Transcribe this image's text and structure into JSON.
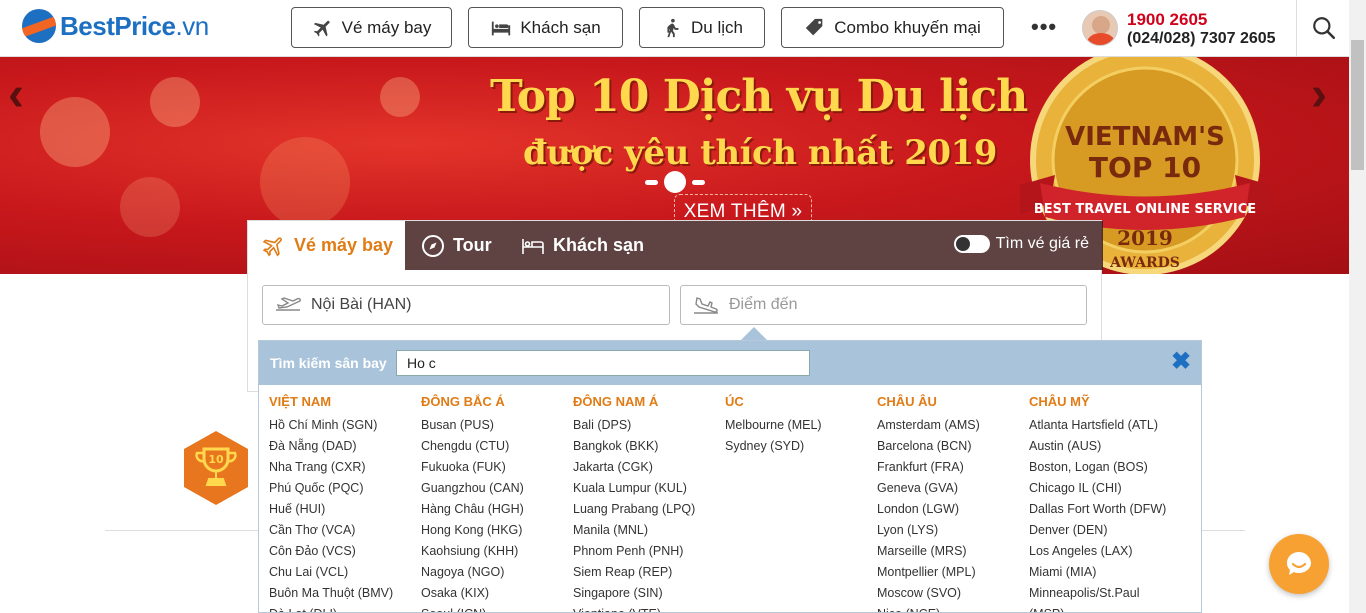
{
  "brand": {
    "logo_text": "BestPrice",
    "logo_suffix": ".vn",
    "brand_color": "#1d6fc2",
    "accent": "#f26522"
  },
  "nav": {
    "items": [
      {
        "label": "Vé máy bay",
        "icon": "plane-icon"
      },
      {
        "label": "Khách sạn",
        "icon": "bed-icon"
      },
      {
        "label": "Du lịch",
        "icon": "hiker-icon"
      },
      {
        "label": "Combo khuyến mại",
        "icon": "tag-icon"
      }
    ],
    "more": "•••",
    "hotline": "1900 2605",
    "phone": "(024/028) 7307 2605"
  },
  "banner": {
    "title": "Top 10 Dịch vụ Du lịch",
    "subtitle": "được yêu thích nhất 2019",
    "cta": "XEM THÊM »",
    "badge_line1": "VIETNAM'S",
    "badge_line2": "TOP 10",
    "badge_ribbon": "BEST TRAVEL ONLINE SERVICE",
    "badge_year": "2019",
    "badge_awards": "AWARDS",
    "prev": "‹",
    "next": "›"
  },
  "search": {
    "tabs": [
      {
        "label": "Vé máy bay",
        "active": true
      },
      {
        "label": "Tour",
        "active": false
      },
      {
        "label": "Khách sạn",
        "active": false
      }
    ],
    "cheap_toggle_label": "Tìm vé giá rẻ",
    "origin_value": "Nội Bài (HAN)",
    "destination_placeholder": "Điểm đến"
  },
  "airport_dropdown": {
    "label": "Tìm kiếm sân bay",
    "query": "Ho c",
    "close": "✖",
    "regions": [
      {
        "name": "VIỆT NAM",
        "airports": [
          "Hồ Chí Minh (SGN)",
          "Đà Nẵng (DAD)",
          "Nha Trang (CXR)",
          "Phú Quốc (PQC)",
          "Huế (HUI)",
          "Cần Thơ (VCA)",
          "Côn Đảo (VCS)",
          "Chu Lai (VCL)",
          "Buôn Ma Thuột (BMV)",
          "Đà Lạt (DLI)"
        ]
      },
      {
        "name": "ĐÔNG BẮC Á",
        "airports": [
          "Busan (PUS)",
          "Chengdu (CTU)",
          "Fukuoka (FUK)",
          "Guangzhou (CAN)",
          "Hàng Châu (HGH)",
          "Hong Kong (HKG)",
          "Kaohsiung (KHH)",
          "Nagoya (NGO)",
          "Osaka (KIX)",
          "Seoul (ICN)"
        ]
      },
      {
        "name": "ĐÔNG NAM Á",
        "airports": [
          "Bali (DPS)",
          "Bangkok (BKK)",
          "Jakarta (CGK)",
          "Kuala Lumpur (KUL)",
          "Luang Prabang (LPQ)",
          "Manila (MNL)",
          "Phnom Penh (PNH)",
          "Siem Reap (REP)",
          "Singapore (SIN)",
          "Vientiane (VTE)"
        ]
      },
      {
        "name": "ÚC",
        "airports": [
          "Melbourne (MEL)",
          "Sydney (SYD)"
        ]
      },
      {
        "name": "CHÂU ÂU",
        "airports": [
          "Amsterdam (AMS)",
          "Barcelona (BCN)",
          "Frankfurt (FRA)",
          "Geneva (GVA)",
          "London (LGW)",
          "Lyon (LYS)",
          "Marseille (MRS)",
          "Montpellier (MPL)",
          "Moscow (SVO)",
          "Nice (NCE)"
        ]
      },
      {
        "name": "CHÂU MỸ",
        "airports": [
          "Atlanta Hartsfield (ATL)",
          "Austin (AUS)",
          "Boston, Logan (BOS)",
          "Chicago IL (CHI)",
          "Dallas Fort Worth (DFW)",
          "Denver (DEN)",
          "Los Angeles (LAX)",
          "Miami (MIA)",
          "Minneapolis/St.Paul",
          "(MSP)"
        ]
      }
    ]
  },
  "misc": {
    "trophy_number": "10"
  }
}
